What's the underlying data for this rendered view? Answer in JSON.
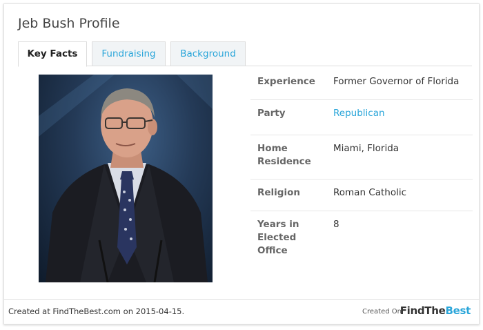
{
  "profile": {
    "title": "Jeb Bush Profile"
  },
  "tabs": [
    {
      "label": "Key Facts",
      "active": true
    },
    {
      "label": "Fundraising",
      "active": false
    },
    {
      "label": "Background",
      "active": false
    }
  ],
  "facts": [
    {
      "label": "Experience",
      "value": "Former Governor of Florida"
    },
    {
      "label": "Party",
      "value": "Republican"
    },
    {
      "label": "Home Residence",
      "value": "Miami, Florida"
    },
    {
      "label": "Religion",
      "value": "Roman Catholic"
    },
    {
      "label": "Years in Elected Office",
      "value": "8"
    }
  ],
  "footer": {
    "created_text": "Created at FindTheBest.com on 2015-04-15.",
    "created_on": "Created On",
    "logo_main": "FindThe",
    "logo_accent": "Best"
  },
  "colors": {
    "accent": "#29a5d9",
    "label": "#666666",
    "border": "#dcdcdc"
  }
}
